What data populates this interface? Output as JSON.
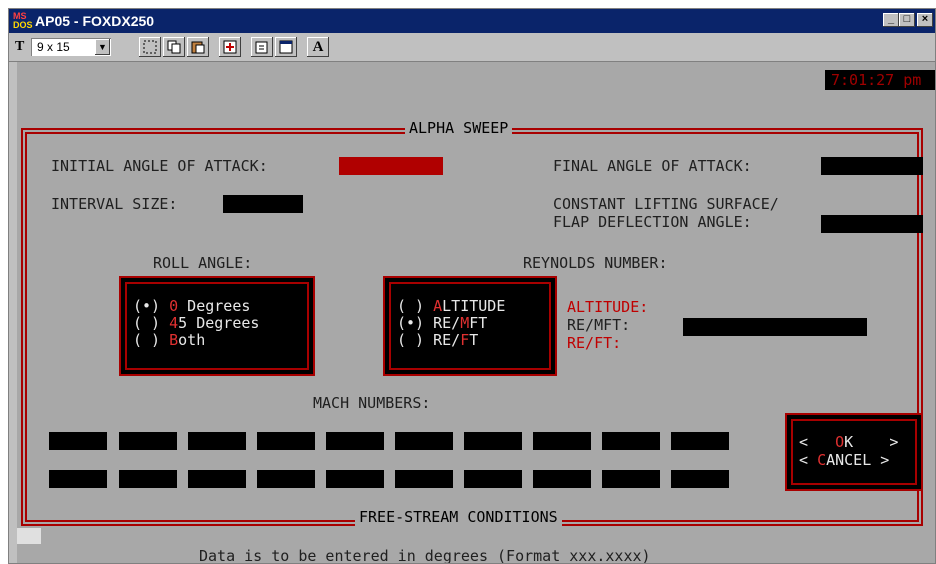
{
  "window": {
    "title": "AP05 - FOXDX250",
    "logo_top": "MS",
    "logo_bottom": "DOS",
    "minimize": "_",
    "maximize": "□",
    "close": "×"
  },
  "toolbar": {
    "font_icon": "T",
    "font_size": "9 x 15",
    "icons": [
      "mark-icon",
      "copy-icon",
      "paste-icon",
      "fullscreen-icon",
      "properties-icon",
      "background-icon",
      "font-icon"
    ],
    "font_button": "A"
  },
  "terminal": {
    "clock": "7:01:27 pm",
    "frame_title": "ALPHA SWEEP",
    "initial_aoa_label": "INITIAL ANGLE OF ATTACK:",
    "final_aoa_label": "FINAL ANGLE OF ATTACK:",
    "interval_label": "INTERVAL SIZE:",
    "constant_line1": "CONSTANT LIFTING SURFACE/",
    "constant_line2": "FLAP DEFLECTION ANGLE:",
    "roll_angle_label": "ROLL ANGLE:",
    "reynolds_label": "REYNOLDS NUMBER:",
    "roll_options": [
      {
        "mark": "(•)",
        "hotkey": "0",
        "rest": " Degrees"
      },
      {
        "mark": "( )",
        "hotkey": "4",
        "rest": "5 Degrees"
      },
      {
        "mark": "( )",
        "hotkey": "B",
        "rest": "oth"
      }
    ],
    "reynolds_options": [
      {
        "mark": "( )",
        "pre": "",
        "hotkey": "A",
        "rest": "LTITUDE"
      },
      {
        "mark": "(•)",
        "pre": "RE/",
        "hotkey": "M",
        "rest": "FT"
      },
      {
        "mark": "( )",
        "pre": "RE/",
        "hotkey": "F",
        "rest": "T"
      }
    ],
    "altitude_label": "ALTITUDE:",
    "remft_label": "RE/MFT:",
    "reft_label": "RE/FT:",
    "mach_label": "MACH NUMBERS:",
    "ok_left": "<",
    "ok_hotkey": "O",
    "ok_rest": "K",
    "ok_right": ">",
    "cancel_left": "<",
    "cancel_hotkey": "C",
    "cancel_rest": "ANCEL",
    "cancel_right": ">",
    "bottom_title": "FREE-STREAM CONDITIONS",
    "status": "Data is to be entered in degrees (Format xxx.xxxx)"
  },
  "colors": {
    "title_bar": "#0a246a",
    "frame_red": "#a80000",
    "hotkey_red": "#e03030",
    "terminal_bg": "#a8a8a8"
  }
}
